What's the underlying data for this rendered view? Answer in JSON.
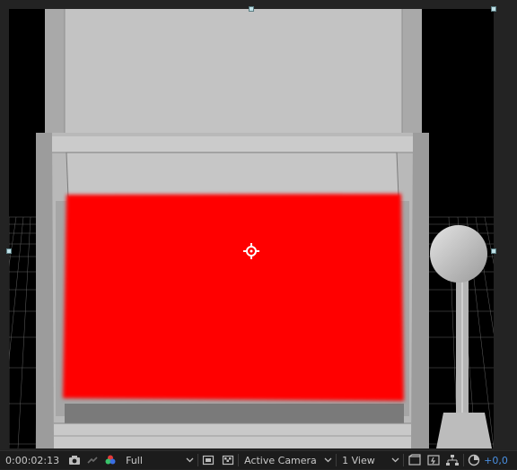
{
  "viewer": {
    "canvas_bg": "#000000",
    "solid_color": "#ff0000",
    "model_gray": "#bfbfbf"
  },
  "toolbar": {
    "timecode": "0:00:02:13",
    "resolution": "Full",
    "camera": "Active Camera",
    "view_layout": "1 View",
    "exposure": "+0,0",
    "icons": [
      "camera-icon",
      "channel-icon",
      "color-icon",
      "region-icon",
      "transparency-grid-icon",
      "fast-preview-icon",
      "draft-3d-icon",
      "flowchart-icon",
      "reset-exposure-icon"
    ]
  }
}
